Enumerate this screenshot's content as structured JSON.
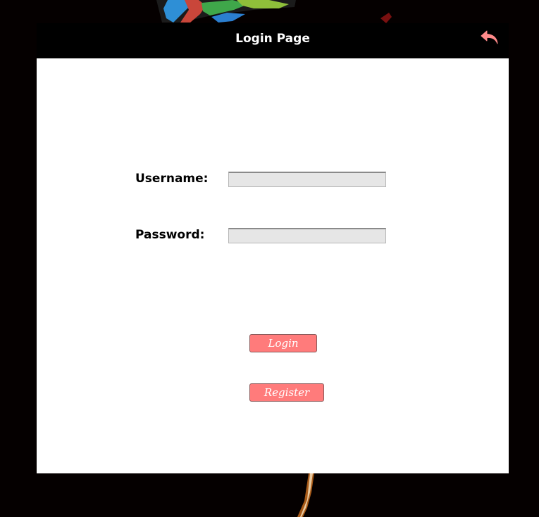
{
  "window": {
    "title": "Login Page",
    "back_icon": "undo-arrow-icon",
    "accent_color": "#ff7b7b"
  },
  "form": {
    "username_label": "Username:",
    "username_value": "",
    "password_label": "Password:",
    "password_value": ""
  },
  "actions": {
    "login_label": "Login",
    "register_label": "Register"
  }
}
